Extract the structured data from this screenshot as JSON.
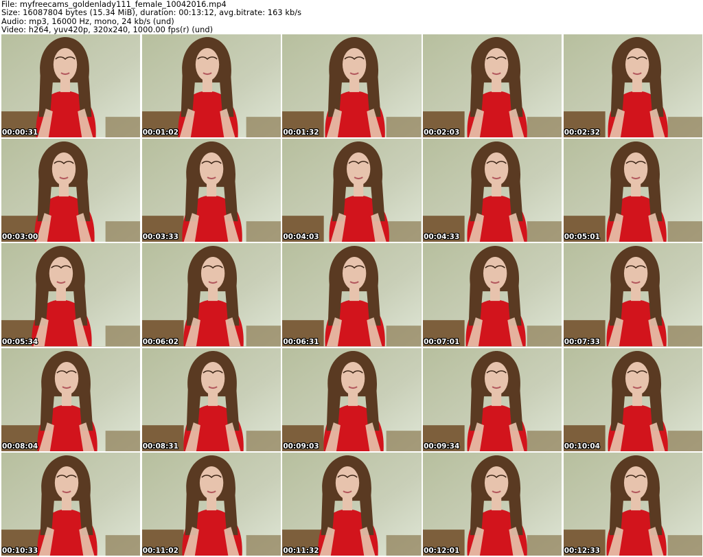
{
  "header": {
    "file_line": "File: myfreecams_goldenlady111_female_10042016.mp4",
    "size_line": "Size: 16087804 bytes (15.34 MiB), duration: 00:13:12, avg.bitrate: 163 kb/s",
    "audio_line": "Audio: mp3, 16000 Hz, mono, 24 kb/s (und)",
    "video_line": "Video: h264, yuv420p, 320x240, 1000.00 fps(r) (und)"
  },
  "colors": {
    "wall": "#c9cfb8",
    "sofa": "#7d5f3c",
    "dress": "#d2141c",
    "hair": "#5a3a22",
    "skin": "#e7c3ad"
  },
  "thumbnails": [
    {
      "timestamp": "00:00:31"
    },
    {
      "timestamp": "00:01:02"
    },
    {
      "timestamp": "00:01:32"
    },
    {
      "timestamp": "00:02:03"
    },
    {
      "timestamp": "00:02:32"
    },
    {
      "timestamp": "00:03:00"
    },
    {
      "timestamp": "00:03:33"
    },
    {
      "timestamp": "00:04:03"
    },
    {
      "timestamp": "00:04:33"
    },
    {
      "timestamp": "00:05:01"
    },
    {
      "timestamp": "00:05:34"
    },
    {
      "timestamp": "00:06:02"
    },
    {
      "timestamp": "00:06:31"
    },
    {
      "timestamp": "00:07:01"
    },
    {
      "timestamp": "00:07:33"
    },
    {
      "timestamp": "00:08:04"
    },
    {
      "timestamp": "00:08:31"
    },
    {
      "timestamp": "00:09:03"
    },
    {
      "timestamp": "00:09:34"
    },
    {
      "timestamp": "00:10:04"
    },
    {
      "timestamp": "00:10:33"
    },
    {
      "timestamp": "00:11:02"
    },
    {
      "timestamp": "00:11:32"
    },
    {
      "timestamp": "00:12:01"
    },
    {
      "timestamp": "00:12:33"
    }
  ]
}
